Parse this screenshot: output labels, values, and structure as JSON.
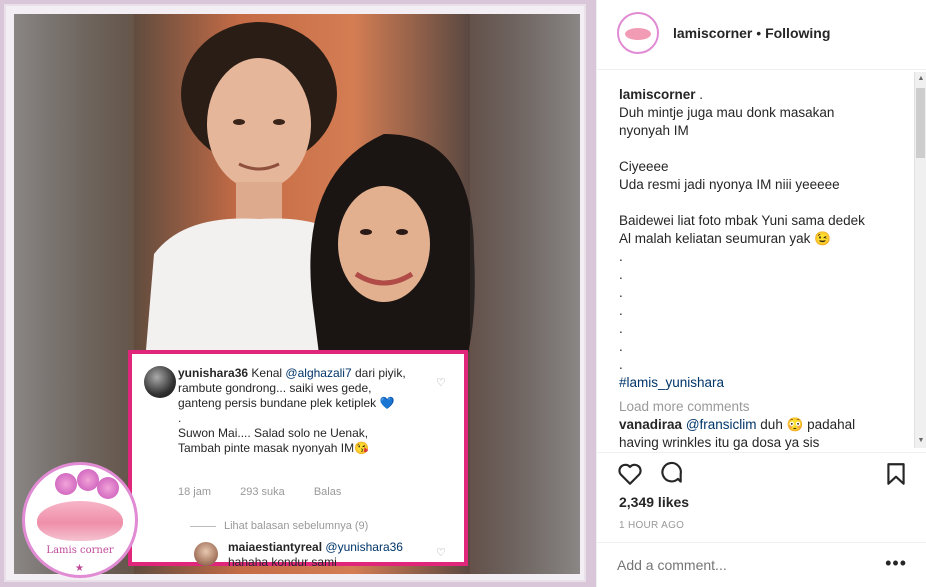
{
  "post": {
    "username": "lamiscorner",
    "follow_label": "Following",
    "caption": "Duh mintje juga mau donk masakan\nnyonyah IM\n\nCiyeeee\nUda resmi jadi nyonya IM niii yeeeee\n\nBaidewei liat foto mbak Yuni sama dedek\nAl malah keliatan seumuran yak 😉\n.\n.\n.\n.\n.\n.\n.",
    "hashtag": "#lamis_yunishara",
    "load_more": "Load more comments",
    "comments": [
      {
        "user": "vanadiraa",
        "mention": "@fransiclim",
        "text": "duh 😳 padahal having wrinkles itu ga dosa ya sis"
      }
    ],
    "likes": "2,349 likes",
    "timestamp": "1 HOUR AGO",
    "add_comment_placeholder": "Add a comment..."
  },
  "embedded": {
    "comment1_user": "yunishara36",
    "comment1_pre": "Kenal ",
    "comment1_mention": "@alghazali7",
    "comment1_text1": " dari piyik, rambute gondrong... saiki wes gede, ganteng persis bundane  plek ketiplek 💙",
    "comment1_dot": ".",
    "comment1_text2": "Suwon Mai.... Salad solo ne Uenak, Tambah pinte masak nyonyah IM😘",
    "meta_time": "18 jam",
    "meta_likes": "293 suka",
    "meta_reply": "Balas",
    "view_replies": "Lihat balasan sebelumnya (9)",
    "comment2_user": "maiaestiantyreal",
    "comment2_mention": "@yunishara36",
    "comment2_text": "hahaha kondur sami"
  },
  "logo": {
    "text": "Lamis corner"
  },
  "icons": {
    "like": "heart-icon",
    "comment": "comment-bubble-icon",
    "save": "bookmark-icon",
    "more": "more-dots-icon"
  },
  "colors": {
    "card_border": "#e0267b",
    "logo_border": "#e08bd3",
    "link": "#003569"
  }
}
